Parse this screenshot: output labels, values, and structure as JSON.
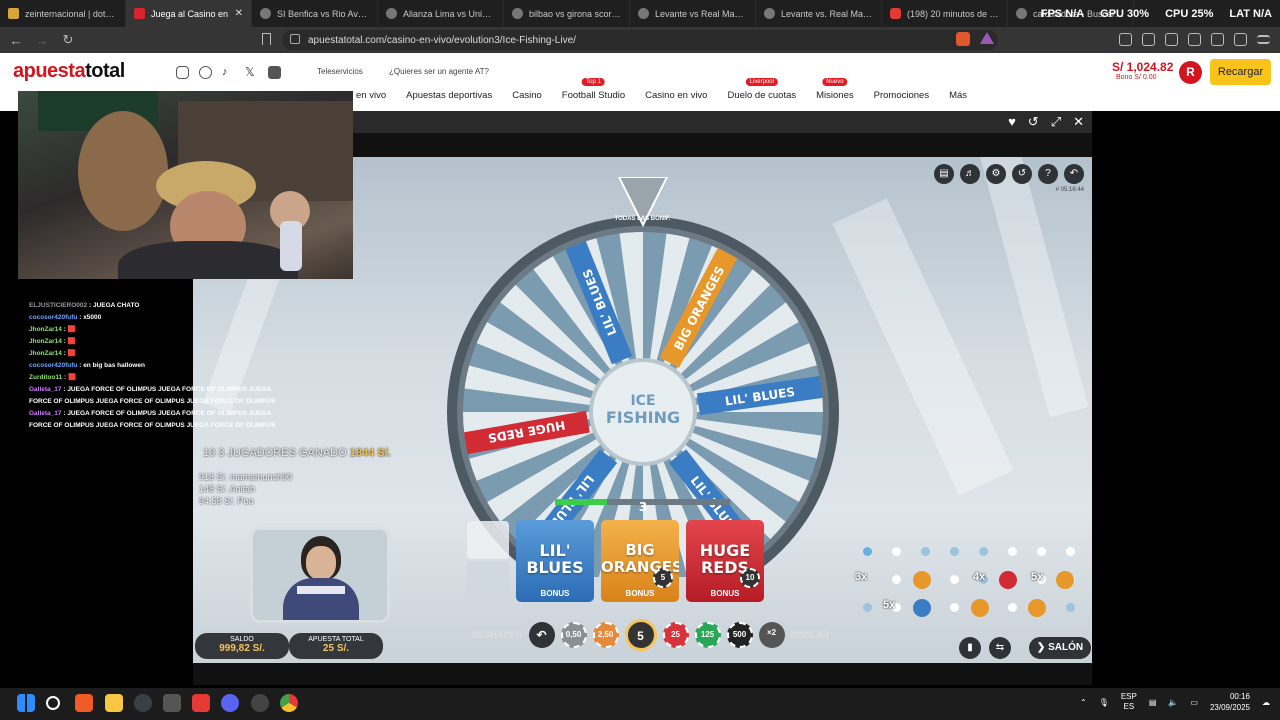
{
  "browser": {
    "tabs": [
      {
        "title": "zeinternacional | dota 2 lm",
        "icon": "gold"
      },
      {
        "title": "Juega al Casino en",
        "icon": "red",
        "active": true
      },
      {
        "title": "SI Benfica vs Rio Ave Pron",
        "icon": ""
      },
      {
        "title": "Alianza Lima vs Universida",
        "icon": ""
      },
      {
        "title": "bilbao vs girona score24 p",
        "icon": ""
      },
      {
        "title": "Levante vs Real Madrid Pr",
        "icon": ""
      },
      {
        "title": "Levante vs. Real Madrid sc",
        "icon": ""
      },
      {
        "title": "(198) 20 minutos de músic",
        "icon": "yt"
      },
      {
        "title": "calculadora - Buscar con",
        "icon": ""
      }
    ],
    "perf": {
      "fps_label": "FPS",
      "fps": "N/A",
      "gpu_label": "GPU",
      "gpu": "30%",
      "cpu_label": "CPU",
      "cpu": "25%",
      "lat_label": "LAT",
      "lat": "N/A"
    },
    "url": "apuestatotal.com/casino-en-vivo/evolution3/Ice-Fishing-Live/"
  },
  "site": {
    "logo_main": "apuesta",
    "logo_bold": "total",
    "teleservicios": "Teleservicios",
    "agent_link": "¿Quieres ser un agente AT?",
    "nav": [
      {
        "label": "en vivo",
        "badge": ""
      },
      {
        "label": "Apuestas deportivas",
        "badge": ""
      },
      {
        "label": "Casino",
        "badge": ""
      },
      {
        "label": "Football Studio",
        "badge": "Top 1"
      },
      {
        "label": "Casino en vivo",
        "badge": ""
      },
      {
        "label": "Duelo de cuotas",
        "badge": "Liverpool"
      },
      {
        "label": "Misiones",
        "badge": "Nuevo"
      },
      {
        "label": "Promociones",
        "badge": ""
      },
      {
        "label": "Más",
        "badge": ""
      }
    ],
    "balance": "S/ 1,024.82",
    "bonus": "Bono S/ 0.00",
    "avatar_initial": "R",
    "recharge_label": "Recargar"
  },
  "game": {
    "title": "ICE FISHING",
    "clock": "# 05:16:44",
    "wheel_segments": [
      "LIL' BLUES",
      "BIG ORANGES",
      "HUGE REDS",
      "LIL' BLUES",
      "LIL' BLUES",
      "LIL' BLUES"
    ],
    "pointer_number": "3",
    "win_text_prefix": "10 3 JUGADORES GANADO",
    "win_amount": "1844 S/.",
    "winners": [
      "918 S/. mamamunch90",
      "148 S/. Anitah",
      "94.58 S/. Poo"
    ],
    "bet_cards": [
      {
        "name_1": "LIL'",
        "name_2": "BLUES",
        "tag": "BONUS",
        "color": "#3b7dc4"
      },
      {
        "name_1": "BIG",
        "name_2": "ORANGES",
        "tag": "BONUS",
        "color": "#e8972a"
      },
      {
        "name_1": "HUGE",
        "name_2": "REDS",
        "tag": "BONUS",
        "color": "#d12c34"
      }
    ],
    "card_chip_values": [
      "5",
      "10"
    ],
    "all_bonus_label": "TODAS LAS BONIF.",
    "balance_label": "SALDO",
    "balance_value": "999,82 S/.",
    "total_bet_label": "APUESTA TOTAL",
    "total_bet_value": "25 S/.",
    "undo_label": "DESHACER",
    "double_label": "DOBLAR",
    "double_multiplier": "×2",
    "chips": [
      {
        "value": "0,50",
        "color": "#8a8f95"
      },
      {
        "value": "2,50",
        "color": "#e5893a"
      },
      {
        "value": "5",
        "color": "#333",
        "selected": true
      },
      {
        "value": "25",
        "color": "#d6333b"
      },
      {
        "value": "125",
        "color": "#2aa657"
      },
      {
        "value": "500",
        "color": "#222"
      }
    ],
    "board_multipliers": [
      "3x",
      "4x",
      "5x",
      "5x"
    ],
    "lobby_label": "SALÓN"
  },
  "stream": {
    "chat": [
      {
        "user": "ELJUSTICIERO002",
        "msg": "JUEGA CHATO",
        "cls": "u0"
      },
      {
        "user": "cocosor420fufu",
        "msg": "x5000",
        "cls": "u1"
      },
      {
        "user": "JhonZar14",
        "msg": "🟥",
        "cls": "u2"
      },
      {
        "user": "JhonZar14",
        "msg": "🟥",
        "cls": "u2"
      },
      {
        "user": "JhonZar14",
        "msg": "🟥",
        "cls": "u2"
      },
      {
        "user": "cocosor420fufu",
        "msg": "en big bas hallowen",
        "cls": "u1"
      },
      {
        "user": "Zurditoo11",
        "msg": "🟥",
        "cls": "u2"
      },
      {
        "user": "Galleta_17",
        "msg": "JUEGA FORCE OF OLIMPUS JUEGA FORCE OF OLIMPUS JUEGA FORCE OF OLIMPUS JUEGA FORCE OF OLIMPUS JUEGA FORCE OF OLIMPUS",
        "cls": "u3"
      },
      {
        "user": "Galleta_17",
        "msg": "JUEGA FORCE OF OLIMPUS JUEGA FORCE OF OLIMPUS JUEGA FORCE OF OLIMPUS JUEGA FORCE OF OLIMPUS JUEGA FORCE OF OLIMPUS",
        "cls": "u3"
      }
    ]
  },
  "taskbar": {
    "lang_1": "ESP",
    "lang_2": "ES",
    "time": "00:16",
    "date": "23/09/2025"
  }
}
